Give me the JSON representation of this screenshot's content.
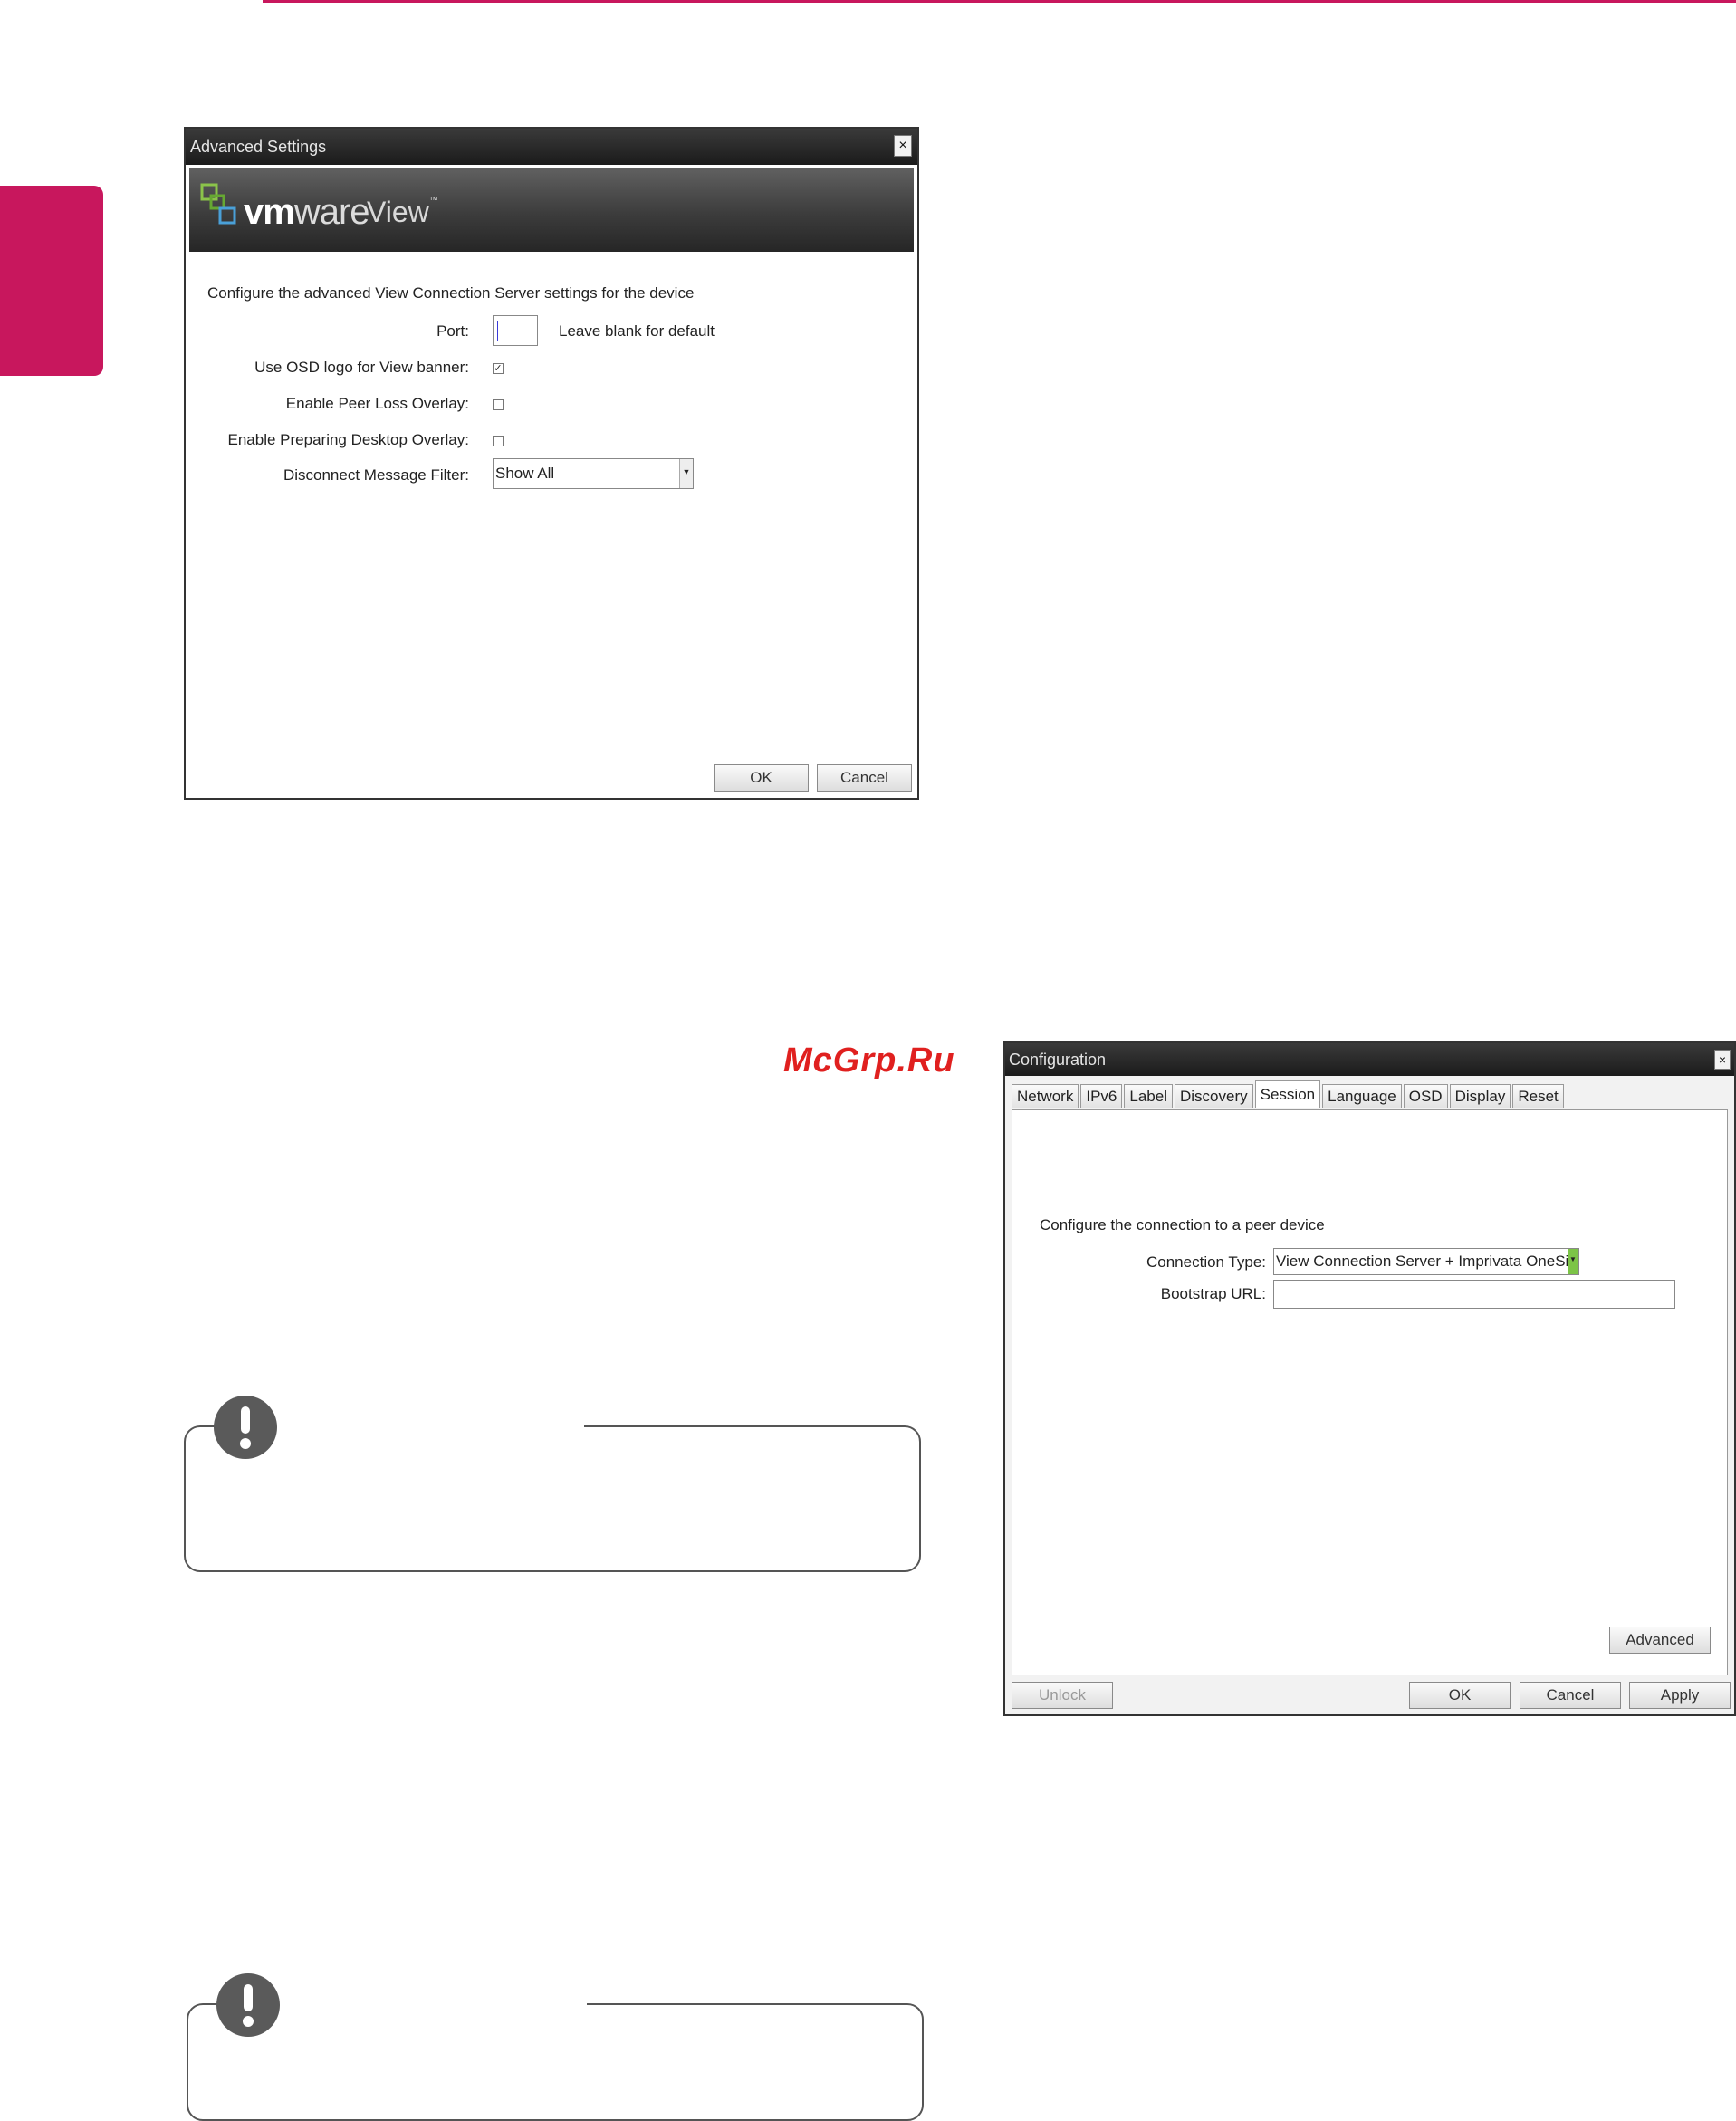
{
  "advanced_dialog": {
    "title": "Advanced Settings",
    "close_label": "×",
    "logo": {
      "vm": "vm",
      "ware": "ware",
      "view": "View",
      "tm": "™"
    },
    "intro": "Configure the advanced View Connection Server settings for the device",
    "port": {
      "label": "Port:",
      "value": "",
      "hint": "Leave blank for default"
    },
    "use_osd_logo": {
      "label": "Use OSD logo for View banner:",
      "checked": true,
      "mark": "✓"
    },
    "peer_loss_overlay": {
      "label": "Enable Peer Loss Overlay:",
      "checked": false
    },
    "preparing_desktop_overlay": {
      "label": "Enable Preparing Desktop Overlay:",
      "checked": false
    },
    "disconnect_filter": {
      "label": "Disconnect Message Filter:",
      "value": "Show All",
      "arrow": "▼"
    },
    "ok_label": "OK",
    "cancel_label": "Cancel"
  },
  "watermark": "McGrp.Ru",
  "config_dialog": {
    "title": "Configuration",
    "close_label": "×",
    "tabs": [
      "Network",
      "IPv6",
      "Label",
      "Discovery",
      "Session",
      "Language",
      "OSD",
      "Display",
      "Reset"
    ],
    "active_tab": "Session",
    "intro": "Configure the connection to a peer device",
    "connection_type": {
      "label": "Connection Type:",
      "value": "View Connection Server + Imprivata OneSign",
      "arrow": "▼"
    },
    "bootstrap_url": {
      "label": "Bootstrap URL:",
      "value": ""
    },
    "advanced_label": "Advanced",
    "unlock_label": "Unlock",
    "ok_label": "OK",
    "cancel_label": "Cancel",
    "apply_label": "Apply"
  },
  "colors": {
    "accent": "#c8175d",
    "titlebar": "#1b1b1b",
    "dropdown_arrow": "#7cc447",
    "watermark": "#e0201f"
  }
}
